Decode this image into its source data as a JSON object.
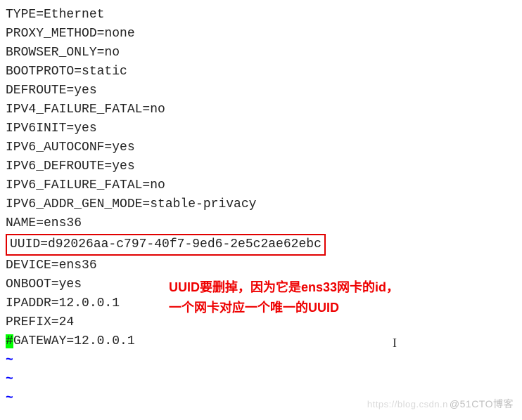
{
  "config": {
    "lines": [
      "TYPE=Ethernet",
      "PROXY_METHOD=none",
      "BROWSER_ONLY=no",
      "BOOTPROTO=static",
      "DEFROUTE=yes",
      "IPV4_FAILURE_FATAL=no",
      "IPV6INIT=yes",
      "IPV6_AUTOCONF=yes",
      "IPV6_DEFROUTE=yes",
      "IPV6_FAILURE_FATAL=no",
      "IPV6_ADDR_GEN_MODE=stable-privacy",
      "NAME=ens36"
    ],
    "uuid_line": "UUID=d92026aa-c797-40f7-9ed6-2e5c2ae62ebc",
    "lines_after": [
      "DEVICE=ens36",
      "ONBOOT=yes",
      "IPADDR=12.0.0.1",
      "PREFIX=24"
    ],
    "gateway_prefix_char": "#",
    "gateway_rest": "GATEWAY=12.0.0.1",
    "tilde": "~"
  },
  "annotation": {
    "line1": "UUID要删掉，因为它是ens33网卡的id，",
    "line2": "一个网卡对应一个唯一的UUID"
  },
  "watermark": {
    "left": "https://blog.csdn.n",
    "right": "@51CTO博客"
  },
  "cursor_char": "I"
}
